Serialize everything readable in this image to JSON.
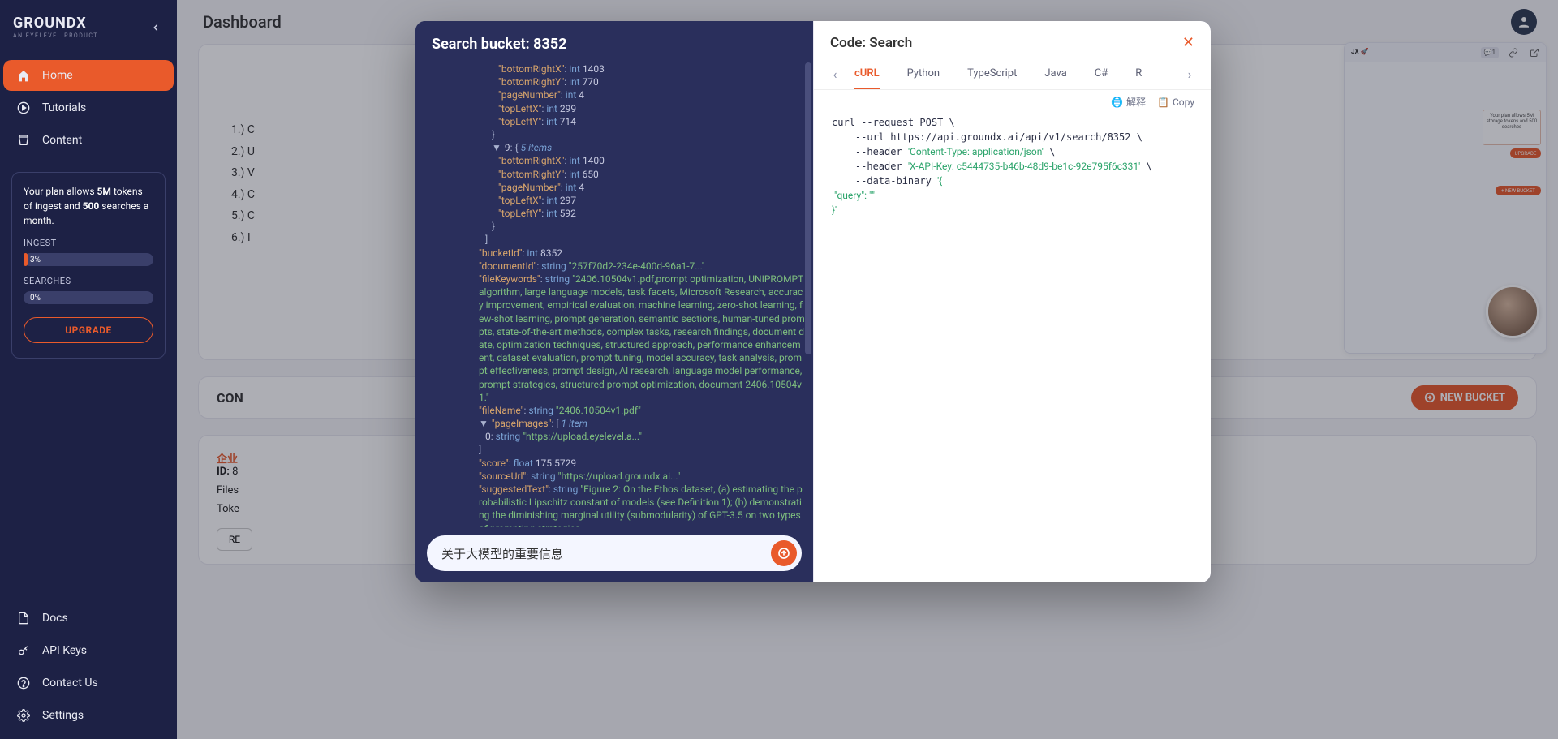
{
  "brand": {
    "name": "GROUNDX",
    "sub": "AN EYELEVEL PRODUCT"
  },
  "page": {
    "title": "Dashboard"
  },
  "sidebar": {
    "items": [
      {
        "label": "Home",
        "name": "home",
        "active": true,
        "icon": "home"
      },
      {
        "label": "Tutorials",
        "name": "tutorials",
        "icon": "play"
      },
      {
        "label": "Content",
        "name": "content",
        "icon": "bucket"
      }
    ],
    "bottom": [
      {
        "label": "Docs",
        "name": "docs",
        "icon": "doc"
      },
      {
        "label": "API Keys",
        "name": "api-keys",
        "icon": "key"
      },
      {
        "label": "Contact Us",
        "name": "contact",
        "icon": "help"
      },
      {
        "label": "Settings",
        "name": "settings",
        "icon": "gear"
      }
    ]
  },
  "plan": {
    "line": "Your plan allows <b>5M</b> tokens of ingest and <b>500</b> searches a month.",
    "ingest_label": "INGEST",
    "ingest_val": "3%",
    "ingest_pct": 3,
    "searches_label": "SEARCHES",
    "searches_val": "0%",
    "searches_pct": 0,
    "upgrade": "UPGRADE"
  },
  "bglist": [
    "1.) C",
    "2.) U",
    "3.) V",
    "4.) C",
    "5.) C",
    "6.) I"
  ],
  "card2": {
    "title": "CON",
    "badge": "企业",
    "new_bucket": "NEW BUCKET"
  },
  "card3": {
    "id_k": "ID:",
    "id_v": "8",
    "files_k": "Files",
    "token_k": "Toke",
    "re": "RE"
  },
  "modal": {
    "left_title": "Search bucket: 8352",
    "search_value": "关于大模型的重要信息"
  },
  "json": {
    "blk8": [
      {
        "k": "bottomRightX",
        "t": "int",
        "v": "1403"
      },
      {
        "k": "bottomRightY",
        "t": "int",
        "v": "770"
      },
      {
        "k": "pageNumber",
        "t": "int",
        "v": "4"
      },
      {
        "k": "topLeftX",
        "t": "int",
        "v": "299"
      },
      {
        "k": "topLeftY",
        "t": "int",
        "v": "714"
      }
    ],
    "blk9_head": {
      "idx": "9",
      "note": "5 items"
    },
    "blk9": [
      {
        "k": "bottomRightX",
        "t": "int",
        "v": "1400"
      },
      {
        "k": "bottomRightY",
        "t": "int",
        "v": "650"
      },
      {
        "k": "pageNumber",
        "t": "int",
        "v": "4"
      },
      {
        "k": "topLeftX",
        "t": "int",
        "v": "297"
      },
      {
        "k": "topLeftY",
        "t": "int",
        "v": "592"
      }
    ],
    "bucket": {
      "k": "bucketId",
      "t": "int",
      "v": "8352"
    },
    "docId": {
      "k": "documentId",
      "t": "string",
      "v": "\"257f70d2-234e-400d-96a1-7...\""
    },
    "fileKw": {
      "k": "fileKeywords",
      "t": "string",
      "v": "\"2406.10504v1.pdf,prompt optimization, UNIPROMPT algorithm, large language models, task facets, Microsoft Research, accuracy improvement, empirical evaluation, machine learning, zero-shot learning, few-shot learning, prompt generation, semantic sections, human-tuned prompts, state-of-the-art methods, complex tasks, research findings, document date, optimization techniques, structured approach, performance enhancement, dataset evaluation, prompt tuning, model accuracy, task analysis, prompt effectiveness, prompt design, AI research, language model performance, prompt strategies, structured prompt optimization, document 2406.10504v1.\""
    },
    "fileName": {
      "k": "fileName",
      "t": "string",
      "v": "\"2406.10504v1.pdf\""
    },
    "pageImages": {
      "k": "pageImages",
      "note": "1 item",
      "item": {
        "idx": "0",
        "t": "string",
        "v": "\"https://upload.eyelevel.a...\""
      }
    },
    "score": {
      "k": "score",
      "t": "float",
      "v": "175.5729"
    },
    "sourceUrl": {
      "k": "sourceUrl",
      "t": "string",
      "v": "\"https://upload.groundx.ai...\""
    },
    "suggested": {
      "k": "suggestedText",
      "t": "string",
      "v": "\"Figure 2: On the Ethos dataset, (a) estimating the probabilistic Lipschitz constant of models (see Definition 1); (b) demonstrating the diminishing marginal utility (submodularity) of GPT-3.5 on two types of prompting strategies."
    }
  },
  "code": {
    "title": "Code: Search",
    "langs": [
      "cURL",
      "Python",
      "TypeScript",
      "Java",
      "C#",
      "R"
    ],
    "active": "cURL",
    "translate": "解释",
    "copy": "Copy",
    "c1": "curl --request POST \\",
    "c2": "    --url https://api.groundx.ai/api/v1/search/8352 \\",
    "c3": "    --header ",
    "c3s": "'Content-Type: application/json'",
    "c3e": " \\",
    "c4": "    --header ",
    "c4s": "'X-API-Key: c5444735-b46b-48d9-be1c-92e795f6c331'",
    "c4e": " \\",
    "c5": "    --data-binary ",
    "c5s": "'{",
    "c6": " \"query\": \"\"",
    "c7": "}'"
  },
  "preview": {
    "brand": "JX 🚀",
    "msgcount": "1",
    "box_text": "Your plan allows 5M storage tokens and 500 searches",
    "upgrade": "UPGRADE",
    "new_bucket": "+ NEW BUCKET"
  }
}
